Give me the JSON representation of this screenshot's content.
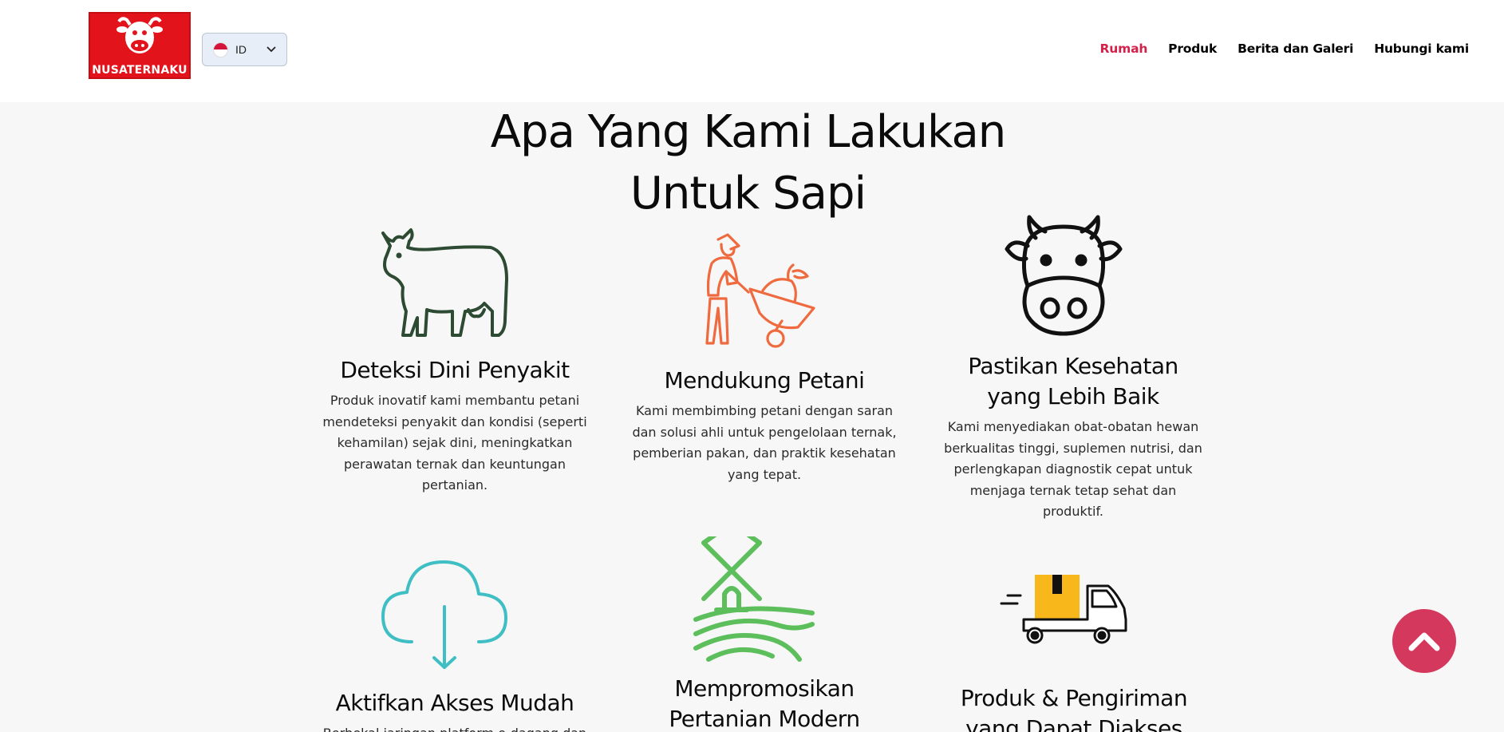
{
  "header": {
    "logo_text": "NUSATERNAKU",
    "language": {
      "code": "ID",
      "flag": "indonesia-flag"
    },
    "nav": [
      {
        "label": "Rumah",
        "active": true
      },
      {
        "label": "Produk",
        "active": false
      },
      {
        "label": "Berita dan Galeri",
        "active": false
      },
      {
        "label": "Hubungi kami",
        "active": false
      }
    ]
  },
  "section": {
    "title_line1": "Apa Yang Kami Lakukan",
    "title_line2": "Untuk Sapi"
  },
  "features": [
    {
      "icon": "cow-icon",
      "title": "Deteksi Dini Penyakit",
      "text": "Produk inovatif kami membantu petani mendeteksi penyakit dan kondisi (seperti kehamilan) sejak dini, meningkatkan perawatan ternak dan keuntungan pertanian."
    },
    {
      "icon": "farmer-wheelbarrow-icon",
      "title": "Mendukung Petani",
      "text": "Kami membimbing petani dengan saran dan solusi ahli untuk pengelolaan ternak, pemberian pakan, dan praktik kesehatan yang tepat."
    },
    {
      "icon": "cow-face-icon",
      "title_line1": "Pastikan Kesehatan",
      "title_line2": "yang Lebih Baik",
      "text": "Kami menyediakan obat-obatan hewan berkualitas tinggi, suplemen nutrisi, dan perlengkapan diagnostik cepat untuk menjaga ternak tetap sehat dan produktif."
    },
    {
      "icon": "cloud-download-icon",
      "title": "Aktifkan Akses Mudah",
      "text": "Berbekal jaringan platform e-dagang dan"
    },
    {
      "icon": "windmill-field-icon",
      "title_line1": "Mempromosikan",
      "title_line2": "Pertanian Modern"
    },
    {
      "icon": "delivery-truck-icon",
      "title_line1": "Produk & Pengiriman",
      "title_line2": "yang Dapat Diakses"
    }
  ],
  "colors": {
    "brand_red": "#e3131b",
    "nav_active": "#d3214a",
    "scroll_top": "#d5385d",
    "cow_green": "#2d4a33",
    "farmer_orange": "#f06a3f",
    "cloud_teal": "#3fbfc4",
    "windmill_green": "#5cbf5c",
    "box_yellow": "#f8b81c"
  },
  "scroll_top_icon": "chevron-up-icon"
}
